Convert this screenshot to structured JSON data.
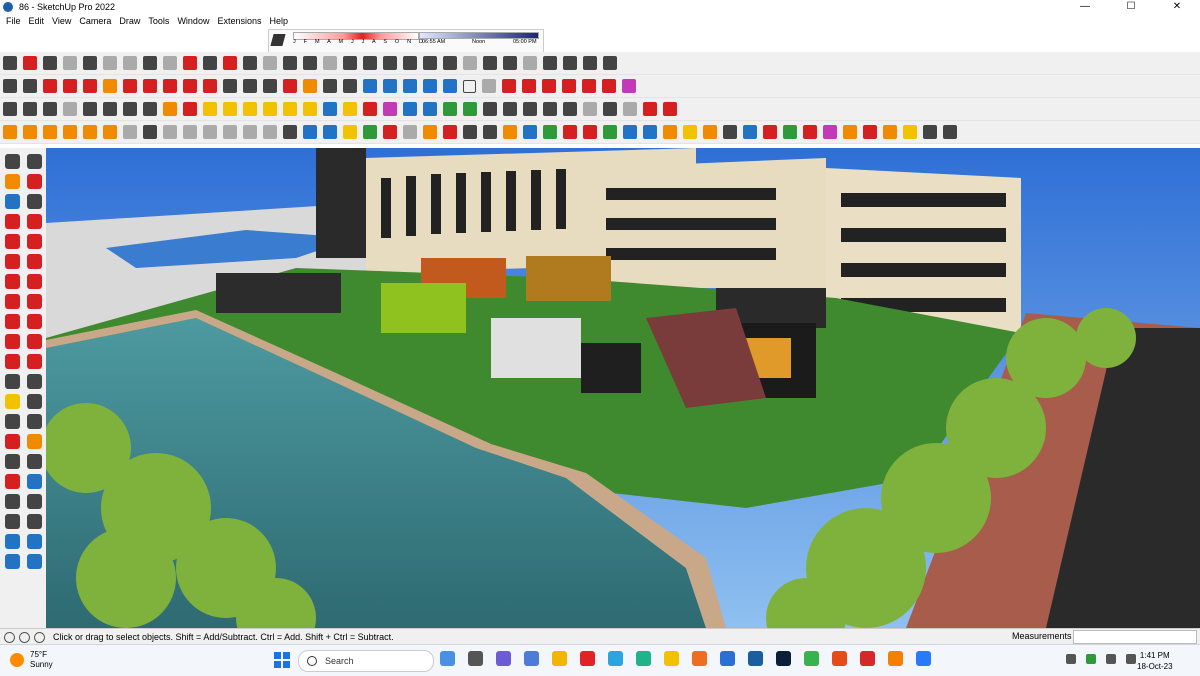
{
  "window": {
    "title": "86 - SketchUp Pro 2022",
    "controls": [
      "—",
      "☐",
      "✕"
    ]
  },
  "menu": [
    "File",
    "Edit",
    "View",
    "Camera",
    "Draw",
    "Tools",
    "Window",
    "Extensions",
    "Help"
  ],
  "shadow_settings": {
    "months": "J F M A M J J A S O N D",
    "time_start": "06:55 AM",
    "time_mid": "Noon",
    "time_end": "05:00 PM"
  },
  "status": {
    "hint": "Click or drag to select objects. Shift = Add/Subtract. Ctrl = Add. Shift + Ctrl = Subtract.",
    "measurements_label": "Measurements",
    "measurements_value": ""
  },
  "taskbar": {
    "weather_temp": "75°F",
    "weather_cond": "Sunny",
    "search_placeholder": "Search",
    "time": "1:41 PM",
    "date": "18-Oct-23"
  },
  "colors": {
    "toolbar_bg": "#f0f0f0",
    "sky_top": "#2f6fd6",
    "sky_bottom": "#8fc0f0",
    "water": "#3c7f86",
    "grass": "#3f8a2e"
  }
}
